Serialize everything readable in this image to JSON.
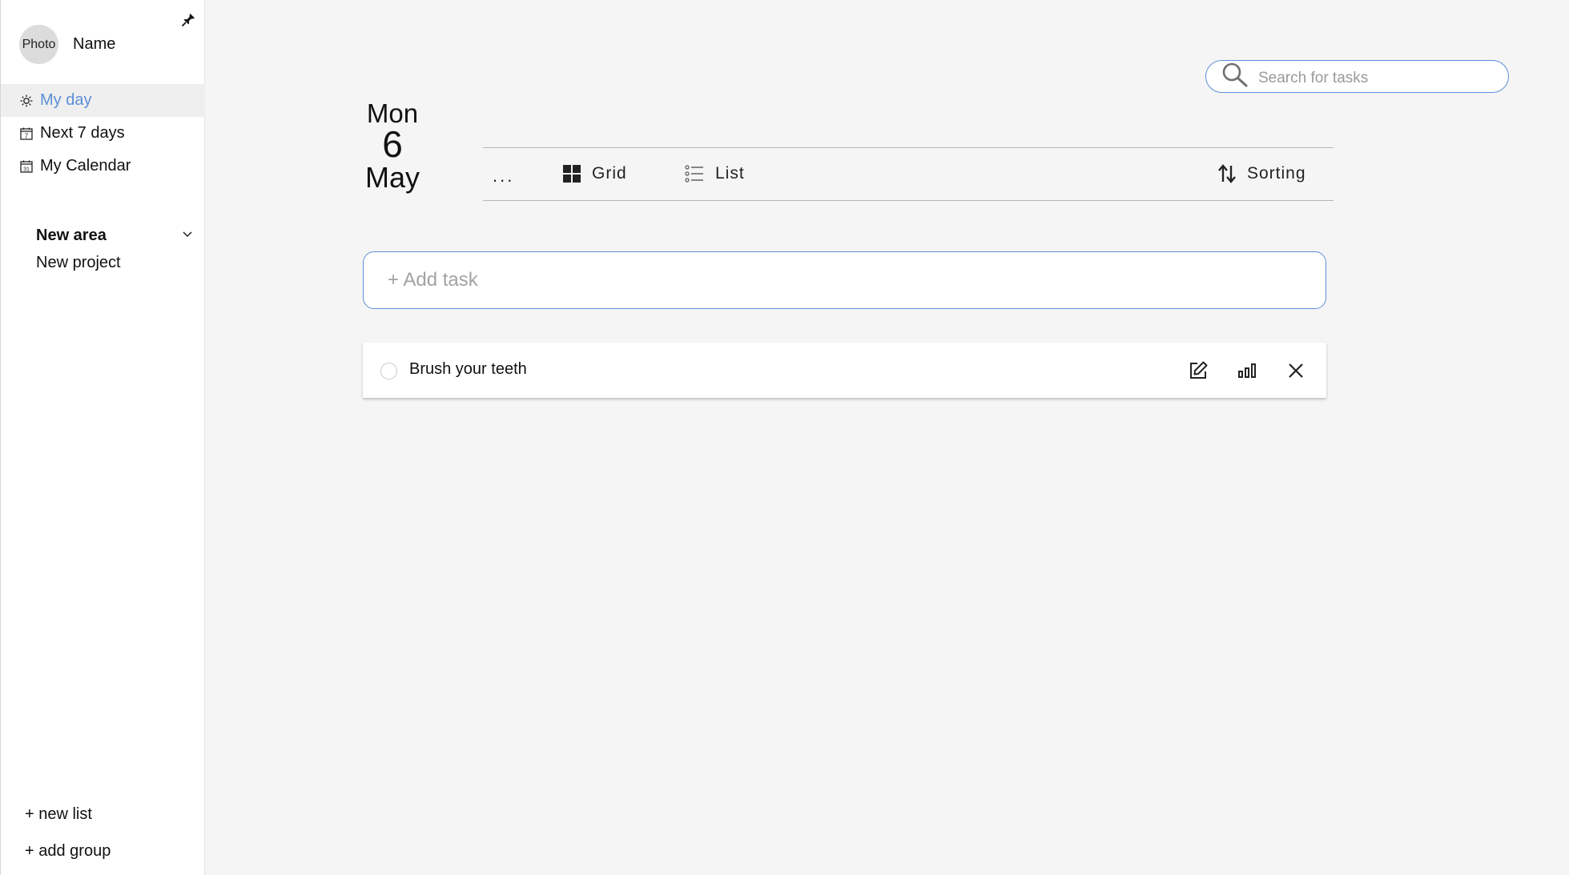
{
  "sidebar": {
    "profile": {
      "photo_label": "Photo",
      "name": "Name"
    },
    "nav": [
      {
        "label": "My day",
        "icon": "sun-icon",
        "active": true
      },
      {
        "label": "Next 7 days",
        "icon": "calendar-7-icon",
        "active": false
      },
      {
        "label": "My Calendar",
        "icon": "calendar-31-icon",
        "active": false
      }
    ],
    "area": {
      "title": "New area",
      "project": "New project"
    },
    "footer": {
      "new_list": "+ new list",
      "add_group": "+ add group"
    }
  },
  "search": {
    "placeholder": "Search for tasks",
    "value": ""
  },
  "date": {
    "weekday": "Mon",
    "day": "6",
    "month": "May"
  },
  "toolbar": {
    "more_label": "...",
    "grid_label": "Grid",
    "list_label": "List",
    "sort_label": "Sorting"
  },
  "add_task": {
    "placeholder": "+ Add task",
    "value": ""
  },
  "tasks": [
    {
      "title": "Brush your teeth",
      "done": false
    }
  ],
  "colors": {
    "accent": "#5b8fd6",
    "background": "#f5f5f5"
  }
}
